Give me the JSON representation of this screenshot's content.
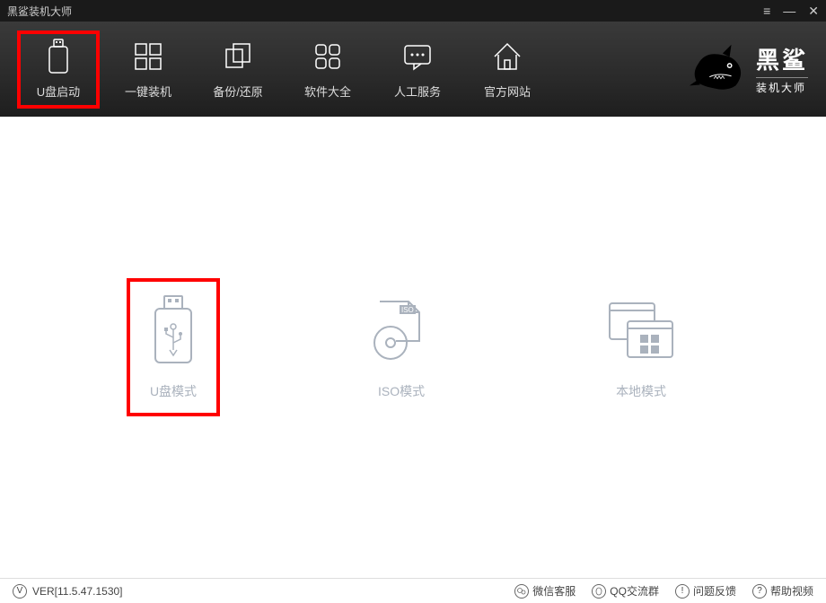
{
  "titlebar": {
    "title": "黑鲨装机大师"
  },
  "nav": {
    "items": [
      {
        "label": "U盘启动"
      },
      {
        "label": "一键装机"
      },
      {
        "label": "备份/还原"
      },
      {
        "label": "软件大全"
      },
      {
        "label": "人工服务"
      },
      {
        "label": "官方网站"
      }
    ]
  },
  "brand": {
    "name": "黑鲨",
    "sub": "装机大师"
  },
  "modes": {
    "usb": "U盘模式",
    "iso": "ISO模式",
    "local": "本地模式"
  },
  "status": {
    "version": "VER[11.5.47.1530]",
    "wechat": "微信客服",
    "qq": "QQ交流群",
    "feedback": "问题反馈",
    "help": "帮助视频"
  }
}
